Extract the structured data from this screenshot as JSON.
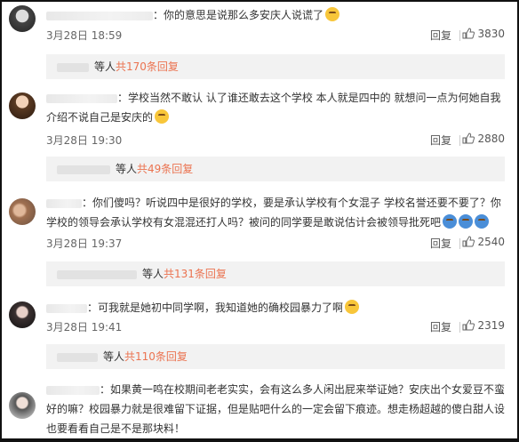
{
  "comments": [
    {
      "text": "：你的意思是说那么多安庆人说谎了",
      "date": "3月28日 18:59",
      "reply": "回复",
      "likes": "3830",
      "sub": {
        "label": "等人",
        "count": "共170条回复"
      }
    },
    {
      "text": "：学校当然不敢认 认了谁还敢去这个学校 本人就是四中的 就想问一点为何她自我介绍不说自己是安庆的",
      "date": "3月28日 19:30",
      "reply": "回复",
      "likes": "2880",
      "sub": {
        "label": "等人",
        "count": "共49条回复"
      }
    },
    {
      "text": "：你们傻吗？听说四中是很好的学校，要是承认学校有个女混子 学校名誉还要不要了？你学校的领导会承认学校有女混混还打人吗？被问的同学要是敢说估计会被领导批死吧",
      "date": "3月28日 19:37",
      "reply": "回复",
      "likes": "2540",
      "sub": {
        "label": "等人",
        "count": "共131条回复"
      }
    },
    {
      "text": "：可我就是她初中同学啊，我知道她的确校园暴力了啊",
      "date": "3月28日 19:41",
      "reply": "回复",
      "likes": "2319",
      "sub": {
        "label": "等人",
        "count": "共110条回复"
      }
    },
    {
      "text": "：如果黄一鸣在校期间老老实实，会有这么多人闲出屁来举证她？安庆出个女爱豆不蛮好的嘛？校园暴力就是很难留下证据，但是贴吧什么的一定会留下痕迹。想走杨超越的傻白甜人设也要看看自己是不是那块料！"
    }
  ],
  "colors": {
    "accent": "#eb7350",
    "subbox_bg": "#f2f2f2"
  }
}
